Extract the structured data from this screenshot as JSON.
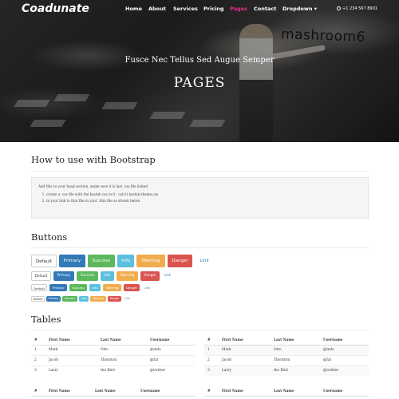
{
  "nav": {
    "logo": "Coadunate",
    "items": [
      "Home",
      "About",
      "Services",
      "Pricing",
      "Pages",
      "Contact",
      "Dropdown"
    ],
    "active_item": "Pages",
    "phone": "+1 234 567 8901"
  },
  "hero": {
    "subtitle": "Fusce Nec Tellus Sed Augue Semper",
    "title": "PAGES",
    "sign_text": "mashroom6"
  },
  "bootstrap_section": {
    "heading": "How to use with Bootstrap",
    "intro": "Add this to your head section, make sure it is last .css file linked",
    "steps": [
      "create a .css file with the bsstab css in it - call it bsstab-theme.css",
      "in your link to that file in your .htm file as shown below"
    ]
  },
  "buttons_section": {
    "heading": "Buttons",
    "labels": [
      "Default",
      "Primary",
      "Success",
      "Info",
      "Warning",
      "Danger",
      "Link"
    ]
  },
  "tables_section": {
    "heading": "Tables",
    "columns": [
      "#",
      "First Name",
      "Last Name",
      "Username"
    ],
    "rows": [
      [
        "1",
        "Mark",
        "Otto",
        "@mdo"
      ],
      [
        "2",
        "Jacob",
        "Thornton",
        "@fat"
      ],
      [
        "3",
        "Larry",
        "the Bird",
        "@twitter"
      ]
    ]
  },
  "colors": {
    "accent": "#e8308a",
    "primary": "#337ab7",
    "success": "#5cb85c",
    "info": "#5bc0de",
    "warning": "#f0ad4e",
    "danger": "#d9534f"
  }
}
